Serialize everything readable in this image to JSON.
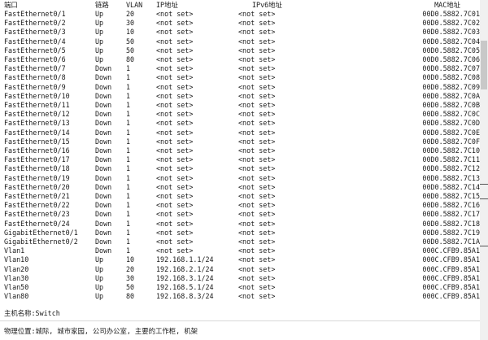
{
  "headers": {
    "port": "端口",
    "link": "链路",
    "vlan": "VLAN",
    "ip": "IP地址",
    "ipv6": "IPv6地址",
    "mac": "MAC地址"
  },
  "rows": [
    {
      "port": "FastEthernet0/1",
      "link": "Up",
      "vlan": "20",
      "ip": "<not set>",
      "ipv6": "<not set>",
      "mac": "00D0.5882.7C01"
    },
    {
      "port": "FastEthernet0/2",
      "link": "Up",
      "vlan": "30",
      "ip": "<not set>",
      "ipv6": "<not set>",
      "mac": "00D0.5882.7C02"
    },
    {
      "port": "FastEthernet0/3",
      "link": "Up",
      "vlan": "10",
      "ip": "<not set>",
      "ipv6": "<not set>",
      "mac": "00D0.5882.7C03"
    },
    {
      "port": "FastEthernet0/4",
      "link": "Up",
      "vlan": "50",
      "ip": "<not set>",
      "ipv6": "<not set>",
      "mac": "00D0.5882.7C04"
    },
    {
      "port": "FastEthernet0/5",
      "link": "Up",
      "vlan": "50",
      "ip": "<not set>",
      "ipv6": "<not set>",
      "mac": "00D0.5882.7C05"
    },
    {
      "port": "FastEthernet0/6",
      "link": "Up",
      "vlan": "80",
      "ip": "<not set>",
      "ipv6": "<not set>",
      "mac": "00D0.5882.7C06"
    },
    {
      "port": "FastEthernet0/7",
      "link": "Down",
      "vlan": "1",
      "ip": "<not set>",
      "ipv6": "<not set>",
      "mac": "00D0.5882.7C07"
    },
    {
      "port": "FastEthernet0/8",
      "link": "Down",
      "vlan": "1",
      "ip": "<not set>",
      "ipv6": "<not set>",
      "mac": "00D0.5882.7C08"
    },
    {
      "port": "FastEthernet0/9",
      "link": "Down",
      "vlan": "1",
      "ip": "<not set>",
      "ipv6": "<not set>",
      "mac": "00D0.5882.7C09"
    },
    {
      "port": "FastEthernet0/10",
      "link": "Down",
      "vlan": "1",
      "ip": "<not set>",
      "ipv6": "<not set>",
      "mac": "00D0.5882.7C0A"
    },
    {
      "port": "FastEthernet0/11",
      "link": "Down",
      "vlan": "1",
      "ip": "<not set>",
      "ipv6": "<not set>",
      "mac": "00D0.5882.7C0B"
    },
    {
      "port": "FastEthernet0/12",
      "link": "Down",
      "vlan": "1",
      "ip": "<not set>",
      "ipv6": "<not set>",
      "mac": "00D0.5882.7C0C"
    },
    {
      "port": "FastEthernet0/13",
      "link": "Down",
      "vlan": "1",
      "ip": "<not set>",
      "ipv6": "<not set>",
      "mac": "00D0.5882.7C0D"
    },
    {
      "port": "FastEthernet0/14",
      "link": "Down",
      "vlan": "1",
      "ip": "<not set>",
      "ipv6": "<not set>",
      "mac": "00D0.5882.7C0E"
    },
    {
      "port": "FastEthernet0/15",
      "link": "Down",
      "vlan": "1",
      "ip": "<not set>",
      "ipv6": "<not set>",
      "mac": "00D0.5882.7C0F"
    },
    {
      "port": "FastEthernet0/16",
      "link": "Down",
      "vlan": "1",
      "ip": "<not set>",
      "ipv6": "<not set>",
      "mac": "00D0.5882.7C10"
    },
    {
      "port": "FastEthernet0/17",
      "link": "Down",
      "vlan": "1",
      "ip": "<not set>",
      "ipv6": "<not set>",
      "mac": "00D0.5882.7C11"
    },
    {
      "port": "FastEthernet0/18",
      "link": "Down",
      "vlan": "1",
      "ip": "<not set>",
      "ipv6": "<not set>",
      "mac": "00D0.5882.7C12"
    },
    {
      "port": "FastEthernet0/19",
      "link": "Down",
      "vlan": "1",
      "ip": "<not set>",
      "ipv6": "<not set>",
      "mac": "00D0.5882.7C13"
    },
    {
      "port": "FastEthernet0/20",
      "link": "Down",
      "vlan": "1",
      "ip": "<not set>",
      "ipv6": "<not set>",
      "mac": "00D0.5882.7C14"
    },
    {
      "port": "FastEthernet0/21",
      "link": "Down",
      "vlan": "1",
      "ip": "<not set>",
      "ipv6": "<not set>",
      "mac": "00D0.5882.7C15"
    },
    {
      "port": "FastEthernet0/22",
      "link": "Down",
      "vlan": "1",
      "ip": "<not set>",
      "ipv6": "<not set>",
      "mac": "00D0.5882.7C16"
    },
    {
      "port": "FastEthernet0/23",
      "link": "Down",
      "vlan": "1",
      "ip": "<not set>",
      "ipv6": "<not set>",
      "mac": "00D0.5882.7C17"
    },
    {
      "port": "FastEthernet0/24",
      "link": "Down",
      "vlan": "1",
      "ip": "<not set>",
      "ipv6": "<not set>",
      "mac": "00D0.5882.7C18"
    },
    {
      "port": "GigabitEthernet0/1",
      "link": "Down",
      "vlan": "1",
      "ip": "<not set>",
      "ipv6": "<not set>",
      "mac": "00D0.5882.7C19"
    },
    {
      "port": "GigabitEthernet0/2",
      "link": "Down",
      "vlan": "1",
      "ip": "<not set>",
      "ipv6": "<not set>",
      "mac": "00D0.5882.7C1A"
    },
    {
      "port": "Vlan1",
      "link": "Down",
      "vlan": "1",
      "ip": "<not set>",
      "ipv6": "<not set>",
      "mac": "000C.CFB9.85A1"
    },
    {
      "port": "Vlan10",
      "link": "Up",
      "vlan": "10",
      "ip": "192.168.1.1/24",
      "ipv6": "<not set>",
      "mac": "000C.CFB9.85A1"
    },
    {
      "port": "Vlan20",
      "link": "Up",
      "vlan": "20",
      "ip": "192.168.2.1/24",
      "ipv6": "<not set>",
      "mac": "000C.CFB9.85A1"
    },
    {
      "port": "Vlan30",
      "link": "Up",
      "vlan": "30",
      "ip": "192.168.3.1/24",
      "ipv6": "<not set>",
      "mac": "000C.CFB9.85A1"
    },
    {
      "port": "Vlan50",
      "link": "Up",
      "vlan": "50",
      "ip": "192.168.5.1/24",
      "ipv6": "<not set>",
      "mac": "000C.CFB9.85A1"
    },
    {
      "port": "Vlan80",
      "link": "Up",
      "vlan": "80",
      "ip": "192.168.8.3/24",
      "ipv6": "<not set>",
      "mac": "000C.CFB9.85A1"
    }
  ],
  "hostname": "主机名称:Switch",
  "location": "物理位置:城际, 城市家园, 公司办公室, 主要的工作柜, 机架"
}
